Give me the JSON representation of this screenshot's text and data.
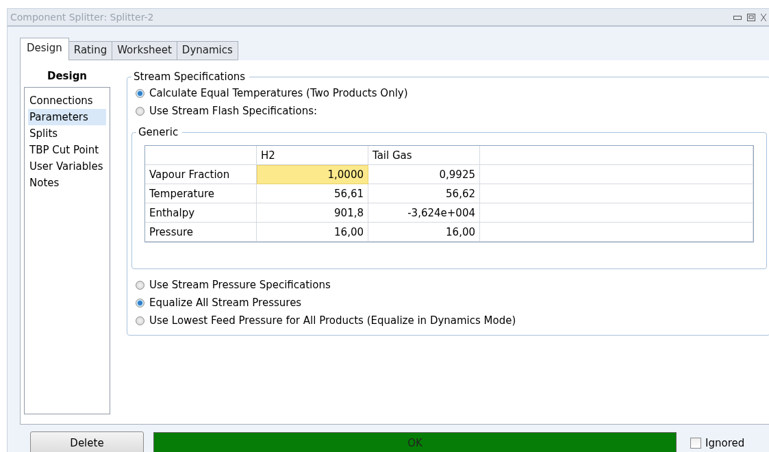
{
  "window": {
    "title": "Component Splitter: Splitter-2"
  },
  "tabs": [
    {
      "label": "Design",
      "selected": true
    },
    {
      "label": "Rating",
      "selected": false
    },
    {
      "label": "Worksheet",
      "selected": false
    },
    {
      "label": "Dynamics",
      "selected": false
    }
  ],
  "sidebar": {
    "title": "Design",
    "items": [
      {
        "label": "Connections",
        "selected": false
      },
      {
        "label": "Parameters",
        "selected": true
      },
      {
        "label": "Splits",
        "selected": false
      },
      {
        "label": "TBP Cut Point",
        "selected": false
      },
      {
        "label": "User Variables",
        "selected": false
      },
      {
        "label": "Notes",
        "selected": false
      }
    ]
  },
  "stream_specifications": {
    "title": "Stream Specifications",
    "options": [
      {
        "label": "Calculate Equal Temperatures (Two Products Only)",
        "selected": true
      },
      {
        "label": "Use Stream Flash Specifications:",
        "selected": false
      }
    ],
    "generic": {
      "title": "Generic",
      "columns": [
        "H2",
        "Tail Gas"
      ],
      "rows": [
        {
          "label": "Vapour Fraction",
          "cells": [
            {
              "value": "1,0000",
              "selected": true
            },
            {
              "value": "0,9925",
              "selected": false
            }
          ]
        },
        {
          "label": "Temperature",
          "cells": [
            {
              "value": "56,61",
              "selected": false
            },
            {
              "value": "56,62",
              "selected": false
            }
          ]
        },
        {
          "label": "Enthalpy",
          "cells": [
            {
              "value": "901,8",
              "selected": false
            },
            {
              "value": "-3,624e+004",
              "selected": false
            }
          ]
        },
        {
          "label": "Pressure",
          "cells": [
            {
              "value": "16,00",
              "selected": false
            },
            {
              "value": "16,00",
              "selected": false
            }
          ]
        }
      ]
    },
    "pressure_options": [
      {
        "label": "Use Stream Pressure Specifications",
        "selected": false
      },
      {
        "label": "Equalize All Stream Pressures",
        "selected": true
      },
      {
        "label": "Use Lowest Feed Pressure for All Products (Equalize in Dynamics Mode)",
        "selected": false
      }
    ]
  },
  "footer": {
    "delete_button": "Delete",
    "status": "OK",
    "ignored": {
      "label": "Ignored",
      "checked": false
    }
  }
}
